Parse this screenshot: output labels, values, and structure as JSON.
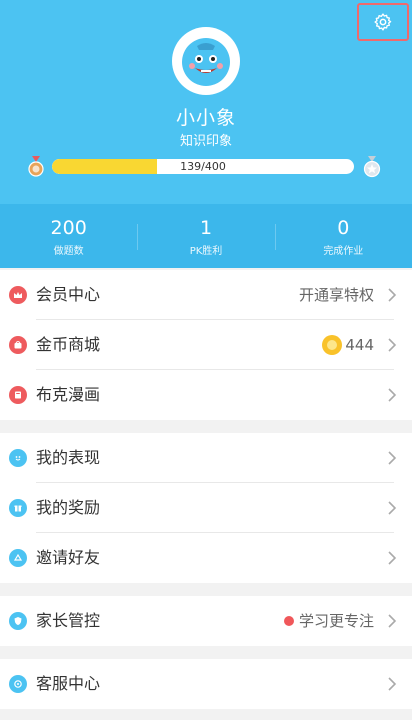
{
  "profile": {
    "nickname": "小小象",
    "subtitle": "知识印象",
    "progress_text": "139/400",
    "progress_fraction": 0.3475
  },
  "stats": [
    {
      "value": "200",
      "label": "做题数"
    },
    {
      "value": "1",
      "label": "PK胜利"
    },
    {
      "value": "0",
      "label": "完成作业"
    }
  ],
  "menu": {
    "vip": {
      "label": "会员中心",
      "value": "开通享特权"
    },
    "coin_shop": {
      "label": "金币商城",
      "value": "444"
    },
    "comics": {
      "label": "布克漫画"
    },
    "performance": {
      "label": "我的表现"
    },
    "rewards": {
      "label": "我的奖励"
    },
    "invite": {
      "label": "邀请好友"
    },
    "parental": {
      "label": "家长管控",
      "value": "学习更专注"
    },
    "service": {
      "label": "客服中心"
    }
  },
  "colors": {
    "header_blue": "#4cc3f2",
    "stats_blue": "#3cb7eb",
    "progress_yellow": "#f9d732",
    "icon_red": "#ee5b5e",
    "icon_blue": "#4cc3f2"
  }
}
